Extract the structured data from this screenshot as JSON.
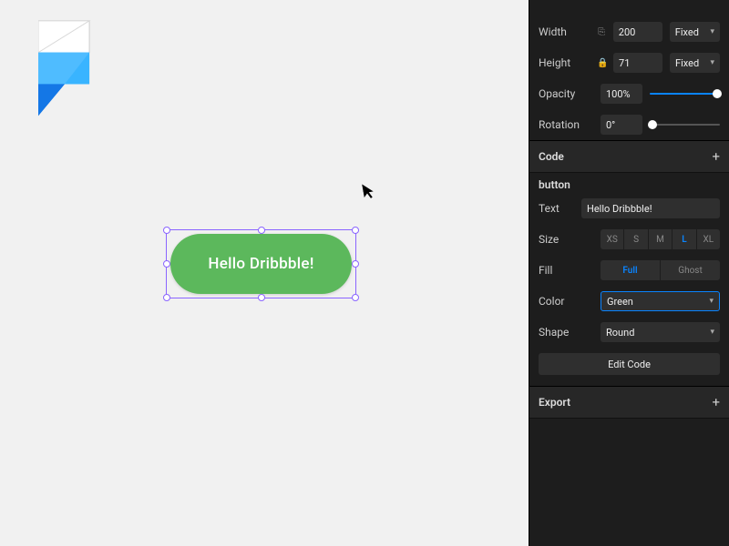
{
  "canvas": {
    "selected_button_text": "Hello Dribbble!"
  },
  "inspector": {
    "geometry": {
      "width_label": "Width",
      "width_value": "200",
      "width_mode": "Fixed",
      "height_label": "Height",
      "height_value": "71",
      "height_mode": "Fixed",
      "opacity_label": "Opacity",
      "opacity_value": "100%",
      "rotation_label": "Rotation",
      "rotation_value": "0°"
    },
    "code_section": {
      "header": "Code",
      "component_name": "button",
      "text_label": "Text",
      "text_value": "Hello Dribbble!",
      "size_label": "Size",
      "size_options": [
        "XS",
        "S",
        "M",
        "L",
        "XL"
      ],
      "size_selected": "L",
      "fill_label": "Fill",
      "fill_options": [
        "Full",
        "Ghost"
      ],
      "fill_selected": "Full",
      "color_label": "Color",
      "color_value": "Green",
      "shape_label": "Shape",
      "shape_value": "Round",
      "edit_code": "Edit Code"
    },
    "export_section": {
      "header": "Export"
    }
  }
}
